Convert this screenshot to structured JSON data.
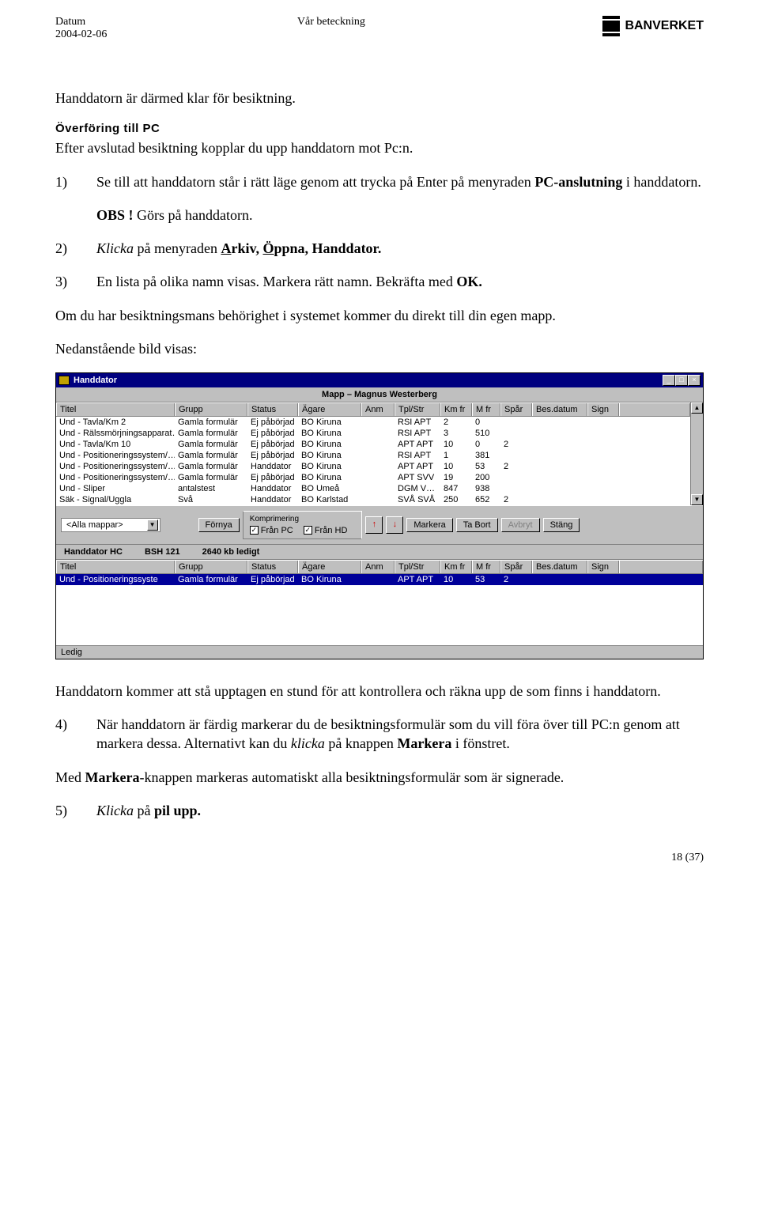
{
  "header": {
    "datum_label": "Datum",
    "datum_value": "2004-02-06",
    "beteck_label": "Vår beteckning",
    "logo_text": "BANVERKET"
  },
  "body": {
    "p1": "Handdatorn är därmed klar för besiktning.",
    "section_title": "Överföring till PC",
    "p2": "Efter avslutad besiktning kopplar du upp handdatorn mot Pc:n.",
    "step1_n": "1)",
    "step1_a": "Se till att handdatorn står i rätt läge genom att trycka på Enter på menyraden ",
    "step1_b": "PC-anslutning",
    "step1_c": " i handdatorn.",
    "obs_line_a": "OBS !",
    "obs_line_b": " Görs på handdatorn.",
    "step2_n": "2)",
    "step2_a": "Klicka",
    "step2_b": " på menyraden ",
    "step2_c": "A",
    "step2_d": "rkiv, ",
    "step2_e": "Ö",
    "step2_f": "ppna, ",
    "step2_g": "Handdator.",
    "step3_n": "3)",
    "step3_a": "En lista på olika namn visas. Markera rätt namn. Bekräfta med ",
    "step3_b": "OK.",
    "p3": "Om du har besiktningsmans behörighet i systemet kommer du direkt till din egen mapp.",
    "p4": "Nedanstående bild visas:",
    "p5": "Handdatorn kommer att stå upptagen en stund för att kontrollera och räkna upp de som finns i handdatorn.",
    "step4_n": "4)",
    "step4_a": "När handdatorn är färdig markerar du de besiktningsformulär som du vill föra över till PC:n genom att markera dessa. Alternativt kan du ",
    "step4_b": "klicka",
    "step4_c": " på knappen ",
    "step4_d": "Markera",
    "step4_e": " i fönstret.",
    "p6_a": "Med ",
    "p6_b": "Markera",
    "p6_c": "-knappen markeras automatiskt alla besiktningsformulär som är signerade.",
    "step5_n": "5)",
    "step5_a": "Klicka",
    "step5_b": " på ",
    "step5_c": "pil upp.",
    "page_num": "18 (37)"
  },
  "win": {
    "title": "Handdator",
    "banner": "Mapp – Magnus Westerberg",
    "cols": [
      "Titel",
      "Grupp",
      "Status",
      "Ägare",
      "Anm",
      "Tpl/Str",
      "Km fr",
      "M fr",
      "Spår",
      "Bes.datum",
      "Sign"
    ],
    "rows": [
      [
        "Und - Tavla/Km 2",
        "Gamla formulär",
        "Ej påbörjad",
        "BO Kiruna",
        "",
        "RSI APT",
        "2",
        "0",
        "",
        "",
        ""
      ],
      [
        "Und - Rälssmörjningsapparat…",
        "Gamla formulär",
        "Ej påbörjad",
        "BO Kiruna",
        "",
        "RSI APT",
        "3",
        "510",
        "",
        "",
        ""
      ],
      [
        "Und - Tavla/Km 10",
        "Gamla formulär",
        "Ej påbörjad",
        "BO Kiruna",
        "",
        "APT APT",
        "10",
        "0",
        "2",
        "",
        ""
      ],
      [
        "Und - Positioneringssystem/…",
        "Gamla formulär",
        "Ej påbörjad",
        "BO Kiruna",
        "",
        "RSI APT",
        "1",
        "381",
        "",
        "",
        ""
      ],
      [
        "Und - Positioneringssystem/…",
        "Gamla formulär",
        "Handdator",
        "BO Kiruna",
        "",
        "APT APT",
        "10",
        "53",
        "2",
        "",
        ""
      ],
      [
        "Und - Positioneringssystem/…",
        "Gamla formulär",
        "Ej påbörjad",
        "BO Kiruna",
        "",
        "APT SVV",
        "19",
        "200",
        "",
        "",
        ""
      ],
      [
        "Und - Sliper",
        "antalstest",
        "Handdator",
        "BO Umeå",
        "",
        "DGM V…",
        "847",
        "938",
        "",
        "",
        ""
      ],
      [
        "Säk - Signal/Uggla",
        "Svå",
        "Handdator",
        "BO Karlstad",
        "",
        "SVÅ SVÅ",
        "250",
        "652",
        "2",
        "",
        ""
      ]
    ],
    "toolbar": {
      "dropdown": "<Alla mappar>",
      "fornya": "Förnya",
      "komp_title": "Komprimering",
      "chk_pc": "Från PC",
      "chk_hd": "Från HD",
      "markera": "Markera",
      "tabort": "Ta Bort",
      "avbryt": "Avbryt",
      "stang": "Stäng"
    },
    "banner2_a": "Handdator HC",
    "banner2_b": "BSH 121",
    "banner2_c": "2640 kb ledigt",
    "row2": [
      "Und - Positioneringssyste",
      "Gamla formulär",
      "Ej påbörjad",
      "BO Kiruna",
      "",
      "APT APT",
      "10",
      "53",
      "2",
      "",
      ""
    ],
    "status": "Ledig"
  }
}
